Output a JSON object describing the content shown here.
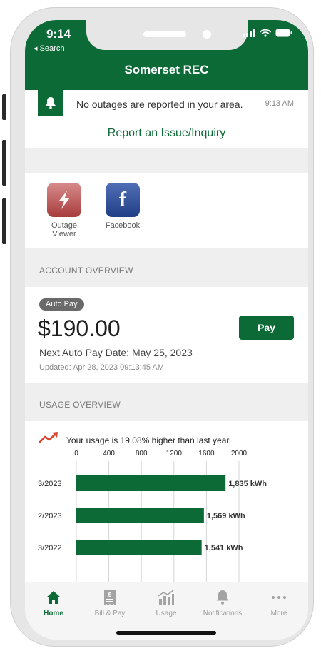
{
  "status_bar": {
    "time": "9:14",
    "back_label": "◂ Search"
  },
  "header": {
    "title": "Somerset REC"
  },
  "outage": {
    "message": "No outages are reported in your area.",
    "time": "9:13 AM",
    "icon": "bell-icon"
  },
  "report_link": "Report an Issue/Inquiry",
  "shortcuts": [
    {
      "label": "Outage\nViewer",
      "icon": "lightning-icon"
    },
    {
      "label": "Facebook",
      "icon": "facebook-icon"
    }
  ],
  "account": {
    "section_title": "ACCOUNT OVERVIEW",
    "badge": "Auto Pay",
    "amount": "$190.00",
    "pay_label": "Pay",
    "next_date": "Next Auto Pay Date: May 25, 2023",
    "updated": "Updated: Apr 28, 2023 09:13:45 AM"
  },
  "usage": {
    "section_title": "USAGE OVERVIEW",
    "note": "Your usage is 19.08% higher than last year."
  },
  "chart_data": {
    "type": "bar",
    "orientation": "horizontal",
    "categories": [
      "3/2023",
      "2/2023",
      "3/2022"
    ],
    "values": [
      1835,
      1569,
      1541
    ],
    "value_labels": [
      "1,835 kWh",
      "1,569 kWh",
      "1,541 kWh"
    ],
    "xlim": [
      0,
      2000
    ],
    "xticks": [
      0,
      400,
      800,
      1200,
      1600,
      2000
    ],
    "grid": true,
    "bar_color": "#0c6a37"
  },
  "tabbar": [
    {
      "label": "Home",
      "icon": "home-icon",
      "active": true
    },
    {
      "label": "Bill & Pay",
      "icon": "bill-icon",
      "active": false
    },
    {
      "label": "Usage",
      "icon": "usage-chart-icon",
      "active": false
    },
    {
      "label": "Notifications",
      "icon": "bell-icon",
      "active": false
    },
    {
      "label": "More",
      "icon": "more-icon",
      "active": false
    }
  ],
  "colors": {
    "brand": "#0c6a37",
    "band": "#efefef"
  }
}
